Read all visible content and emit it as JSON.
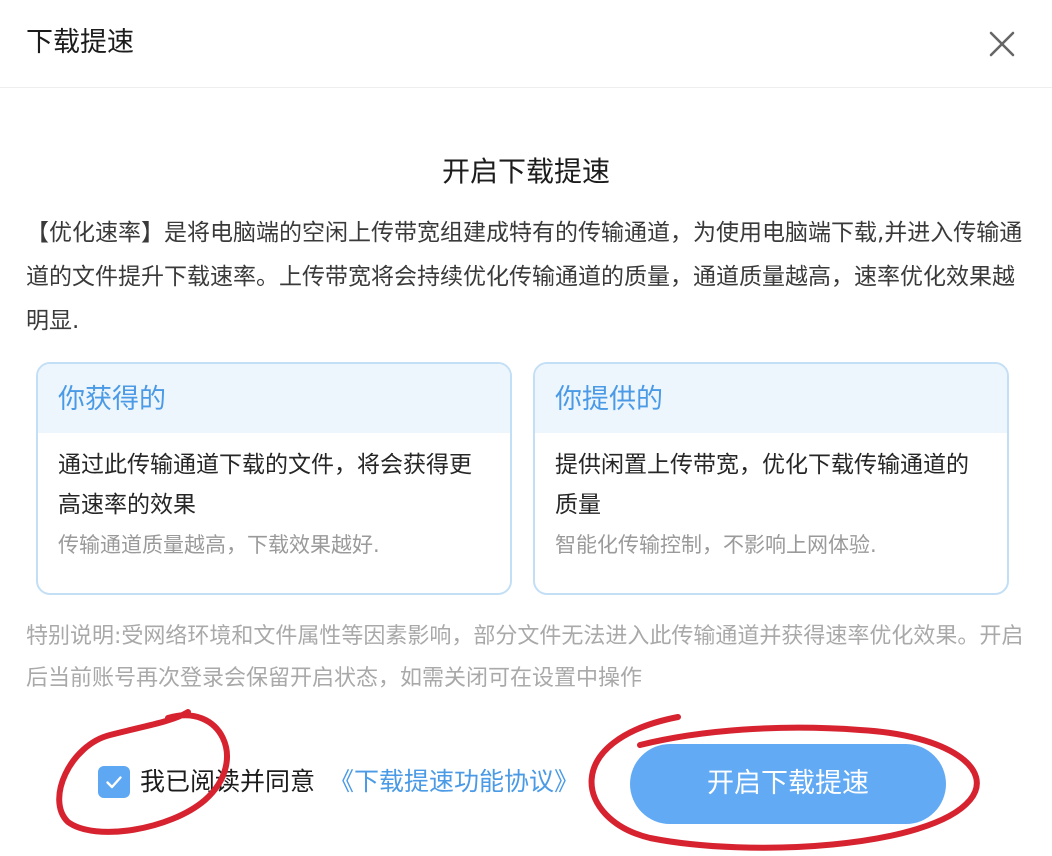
{
  "dialog": {
    "title": "下载提速",
    "close_icon": "close-icon"
  },
  "main": {
    "heading": "开启下载提速",
    "intro": "【优化速率】是将电脑端的空闲上传带宽组建成特有的传输通道，为使用电脑端下载,并进入传输通道的文件提升下载速率。上传带宽将会持续优化传输通道的质量，通道质量越高，速率优化效果越明显."
  },
  "cards": [
    {
      "title": "你获得的",
      "main": "通过此传输通道下载的文件，将会获得更高速率的效果",
      "sub": "传输通道质量越高，下载效果越好."
    },
    {
      "title": "你提供的",
      "main": "提供闲置上传带宽，优化下载传输通道的质量",
      "sub": "智能化传输控制，不影响上网体验."
    }
  ],
  "note": "特别说明:受网络环境和文件属性等因素影响，部分文件无法进入此传输通道并获得速率优化效果。开启后当前账号再次登录会保留开启状态，如需关闭可在设置中操作",
  "agreement": {
    "checked": true,
    "text": "我已阅读并同意",
    "link": "《下载提速功能协议》"
  },
  "primary_button": "开启下载提速",
  "colors": {
    "accent": "#62aaf4",
    "link": "#4a9ae6",
    "annotation": "#d6232f"
  }
}
